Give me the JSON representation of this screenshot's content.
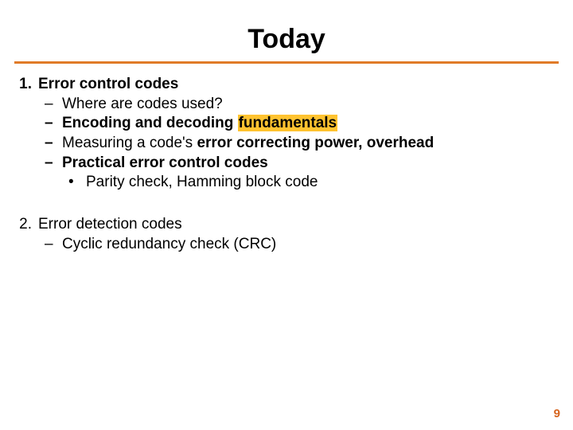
{
  "title": "Today",
  "section1": {
    "num": "1.",
    "heading": "Error control codes",
    "sub1_dash": "–",
    "sub1": "Where are codes used?",
    "sub2_dash": "–",
    "sub2_pre": "Encoding and decoding ",
    "sub2_hl": "fundamentals",
    "sub3_dash": "–",
    "sub3_pre": "Measuring a code's ",
    "sub3_bold": "error correcting power, overhead",
    "sub4_dash": "–",
    "sub4": "Practical error control codes",
    "sub4a_dot": "•",
    "sub4a": "Parity check, Hamming block code"
  },
  "section2": {
    "num": "2.",
    "heading": "Error detection codes",
    "sub1_dash": "–",
    "sub1": "Cyclic redundancy check (CRC)"
  },
  "pagenum": "9"
}
